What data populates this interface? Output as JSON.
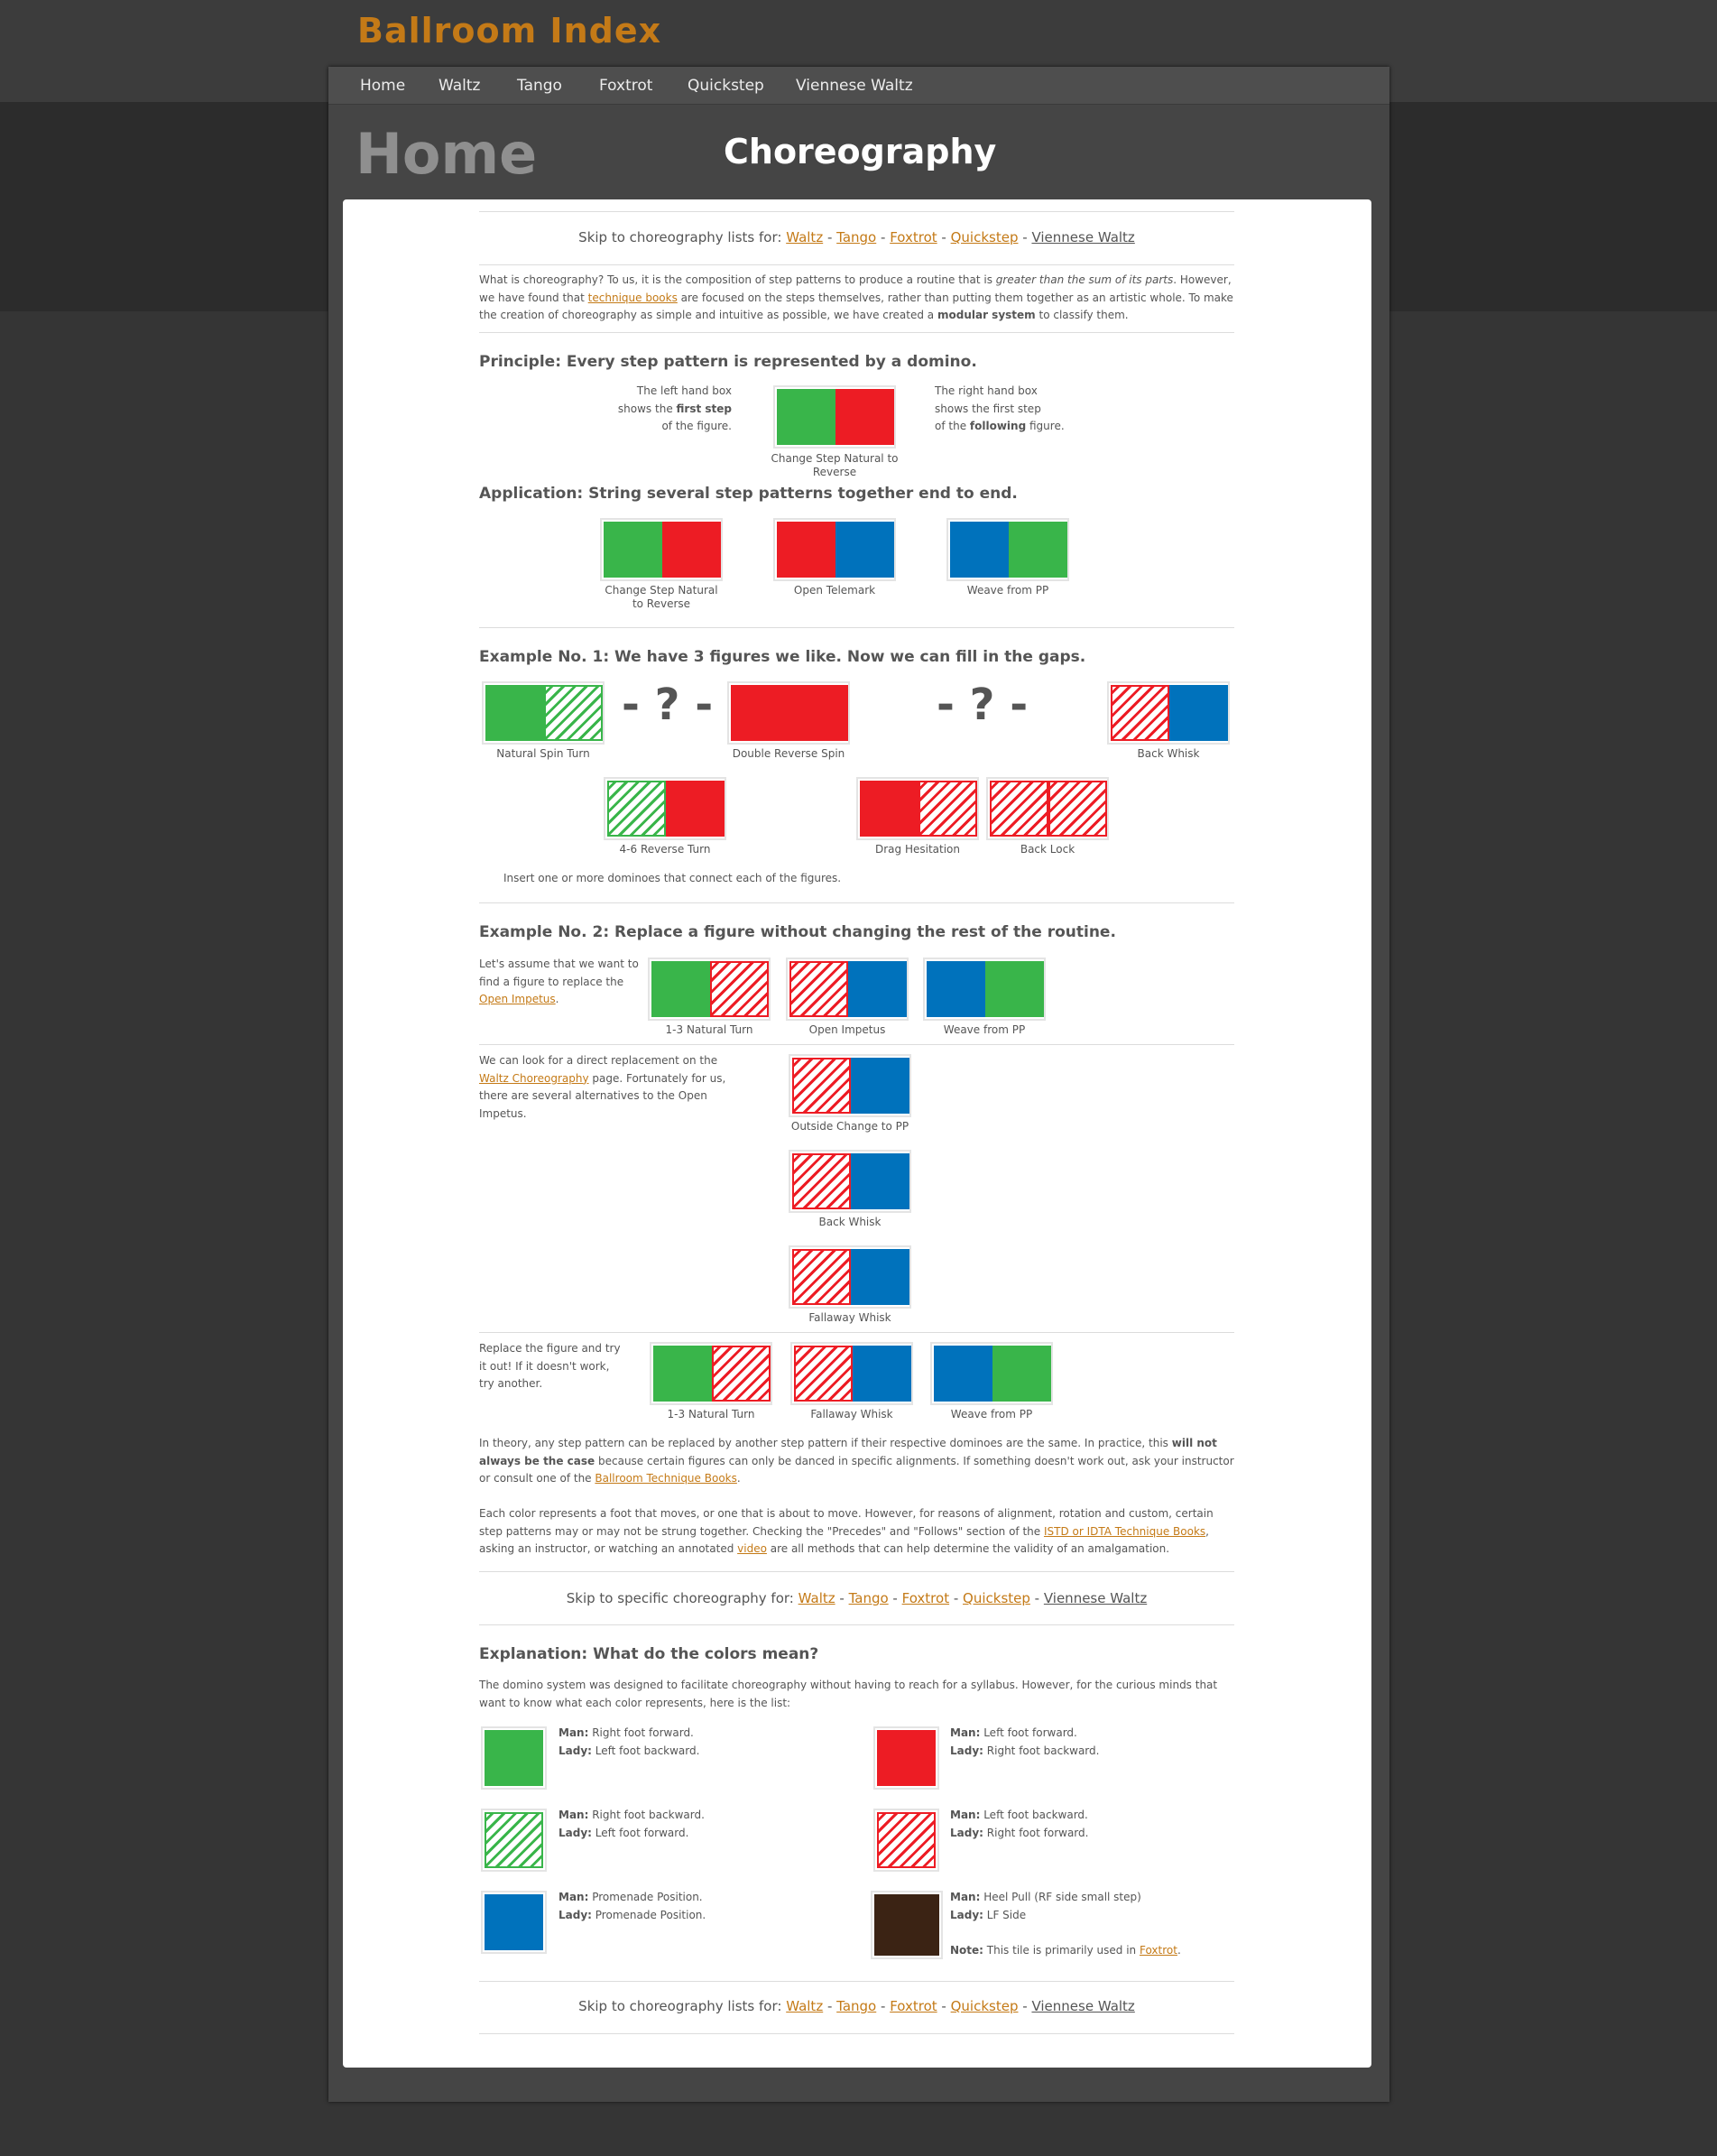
{
  "site": {
    "title": "Ballroom Index"
  },
  "nav": [
    "Home",
    "Waltz",
    "Tango",
    "Foxtrot",
    "Quickstep",
    "Viennese Waltz"
  ],
  "header": {
    "section": "Home",
    "page_title": "Choreography"
  },
  "skip_top": {
    "prefix": "Skip to choreography lists for: ",
    "links": [
      "Waltz",
      "Tango",
      "Foxtrot",
      "Quickstep",
      "Viennese Waltz"
    ]
  },
  "intro": {
    "t1": "What is choreography? To us, it is the composition of step patterns to produce a routine that is ",
    "em": "greater than the sum of its parts",
    "t2": ". However, we have found that ",
    "link": "technique books",
    "t3": " are focused on the steps themselves, rather than putting them together as an artistic whole. To make the creation of choreography as simple and intuitive as possible, we have created a ",
    "strong": "modular system",
    "t4": " to classify them."
  },
  "principle": {
    "heading_bold": "Principle:",
    "heading_rest": " Every step pattern is represented by a domino.",
    "left_1": "The left hand box",
    "left_2a": "shows the ",
    "left_2b": "first step",
    "left_3": "of the figure.",
    "right_1": "The right hand box",
    "right_2": "shows the first step",
    "right_3a": "of the ",
    "right_3b": "following",
    "right_3c": " figure.",
    "caption": "Change Step Natural to Reverse"
  },
  "application": {
    "heading_bold": "Application:",
    "heading_rest": " String several step patterns together end to end.",
    "captions": [
      "Change Step Natural to Reverse",
      "Open Telemark",
      "Weave from PP"
    ]
  },
  "example1": {
    "heading": "Example No. 1: We have 3 figures we like. Now",
    "heading_rest": " we can fill in the gaps.",
    "gap": "- ? -",
    "captions": [
      "Natural Spin Turn",
      "Double Reverse Spin",
      "Back Whisk",
      "4-6 Reverse Turn",
      "Drag Hesitation",
      "Back Lock"
    ],
    "note": "Insert one or more dominoes that connect each of the figures."
  },
  "example2": {
    "heading": "Example No. 2: Replace a figure without changing the rest of the routine.",
    "p1_a": "Let's assume that we want to",
    "p1_b": "find a figure to replace the",
    "p1_link": "Open Impetus",
    "p1_end": ".",
    "row1_captions": [
      "1-3 Natural Turn",
      "Open Impetus",
      "Weave from PP"
    ],
    "p2_a": "We can look for a direct replacement on the ",
    "p2_link": "Waltz Choreography",
    "p2_b": " page. Fortunately for us, there are several alternatives to the Open Impetus.",
    "alt_captions": [
      "Outside Change to PP",
      "Back Whisk",
      "Fallaway Whisk"
    ],
    "p3": "Replace the figure and try it out! If it doesn't work, try another.",
    "row3_captions": [
      "1-3 Natural Turn",
      "Fallaway Whisk",
      "Weave from PP"
    ]
  },
  "theory": {
    "t1": "In theory, any step pattern can be replaced by another step pattern if their respective dominoes are the same.  In practice, this ",
    "strong": "will not always be the case",
    "t2": " because certain figures can only be danced in specific alignments. If something doesn't work out, ask your instructor or consult one of the ",
    "link": "Ballroom Technique Books",
    "t3": "."
  },
  "colors_para": {
    "t1": "Each color represents a foot that moves, or one that is about to move. However, for reasons of alignment, rotation and custom, certain step patterns may or may not be strung together. Checking the \"Precedes\" and \"Follows\" section of the ",
    "link1": "ISTD or IDTA Technique Books",
    "t2": ", asking an instructor, or watching an annotated ",
    "link2": "video",
    "t3": " are all methods that can help determine the validity of an amalgamation."
  },
  "skip_mid": {
    "prefix": "Skip to specific choreography for: ",
    "links": [
      "Waltz",
      "Tango",
      "Foxtrot",
      "Quickstep",
      "Viennese Waltz"
    ]
  },
  "explanation": {
    "heading": "Explanation: What do the colors mean?",
    "intro": "The domino system was designed to facilitate choreography without having to reach for a syllabus. However, for the curious minds that want to know what each color represents, here is the list:",
    "man": "Man:",
    "lady": "Lady:",
    "items": [
      {
        "man": " Right foot forward.",
        "lady": " Left foot backward."
      },
      {
        "man": " Left foot forward.",
        "lady": " Right foot backward."
      },
      {
        "man": " Right foot backward.",
        "lady": " Left foot forward."
      },
      {
        "man": " Left foot backward.",
        "lady": " Right foot forward."
      },
      {
        "man": " Promenade Position.",
        "lady": " Promenade Position."
      },
      {
        "man": " Heel Pull (RF side small step)",
        "lady": " LF Side"
      }
    ],
    "note_label": "Note:",
    "note_text": " This tile is primarily used in ",
    "note_link": "Foxtrot",
    "note_end": "."
  },
  "skip_bottom": {
    "prefix": "Skip to choreography lists for: ",
    "links": [
      "Waltz",
      "Tango",
      "Foxtrot",
      "Quickstep",
      "Viennese Waltz"
    ]
  },
  "colors": {
    "green": "#39b54a",
    "red": "#ed1c24",
    "blue": "#0072bc",
    "brown": "#3b2314",
    "link": "#c47a17"
  }
}
